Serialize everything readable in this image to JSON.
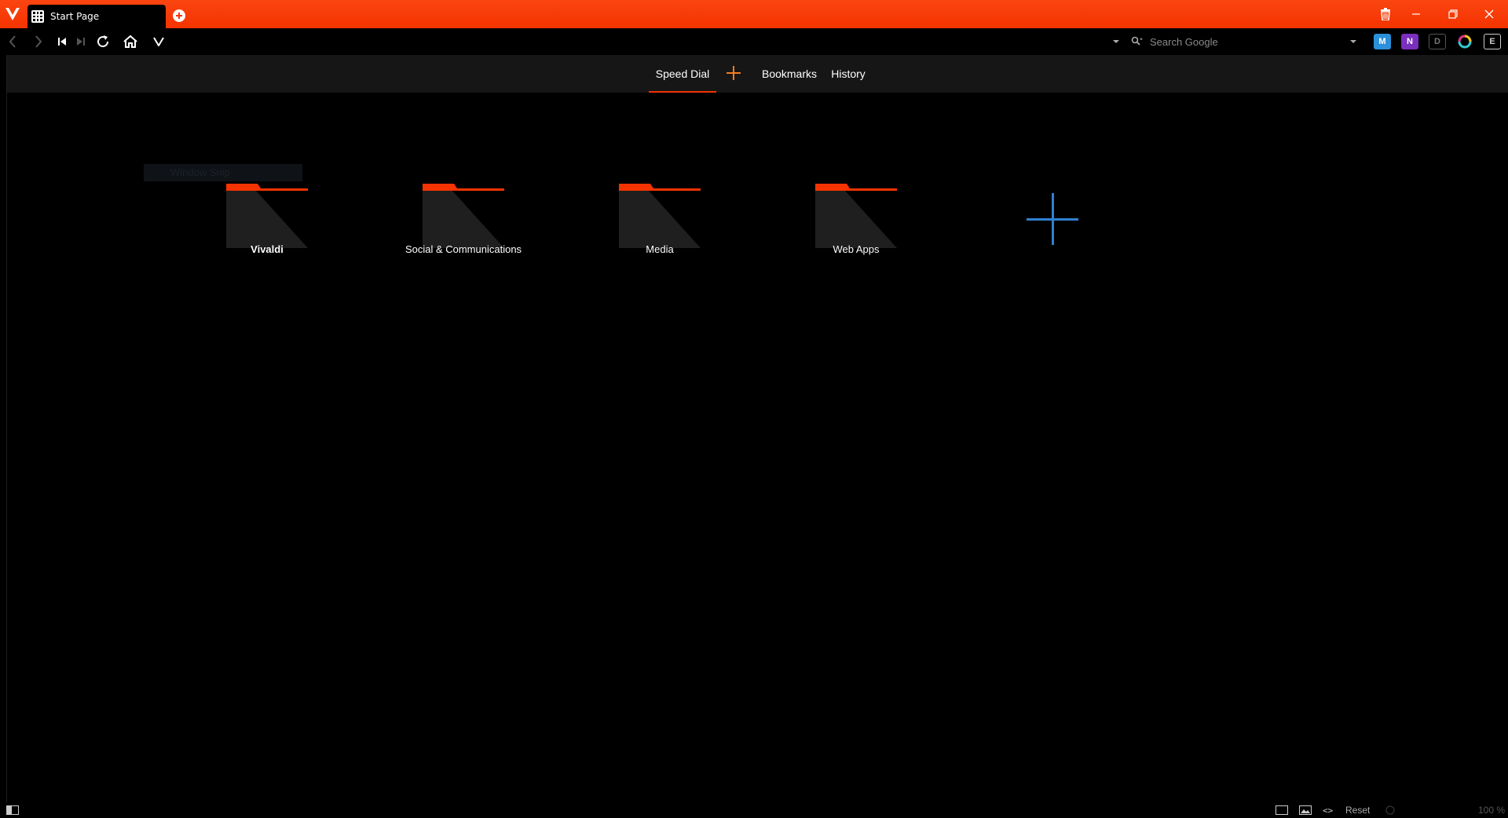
{
  "colors": {
    "accent": "#f43300",
    "add_dial": "#2f80d0",
    "folder_body": "#1f1f1f",
    "nav_bg": "#161616"
  },
  "browser": {
    "tab": {
      "title": "Start Page",
      "favicon": "speed-dial-grid-icon"
    },
    "window_controls": [
      "trash-icon",
      "minimize-icon",
      "restore-icon",
      "close-icon"
    ]
  },
  "toolbar": {
    "nav_icons": [
      "back-icon",
      "forward-icon",
      "rewind-icon",
      "fast-forward-icon",
      "reload-icon",
      "home-icon",
      "vivaldi-v-icon"
    ],
    "address_value": "",
    "search": {
      "placeholder": "Search Google"
    },
    "extensions": [
      "mastodon-icon",
      "onenote-icon",
      "reader-icon",
      "color-wheel-icon",
      "evernote-icon"
    ]
  },
  "startpage": {
    "tabs": [
      {
        "label": "Speed Dial",
        "active": true
      },
      {
        "label": "Bookmarks",
        "active": false
      },
      {
        "label": "History",
        "active": false
      }
    ],
    "ghost_text": "Window Snip",
    "folders": [
      {
        "label": "Vivaldi"
      },
      {
        "label": "Social & Communications"
      },
      {
        "label": "Media"
      },
      {
        "label": "Web Apps"
      }
    ]
  },
  "statusbar": {
    "reset_label": "Reset",
    "zoom": "100 %"
  }
}
